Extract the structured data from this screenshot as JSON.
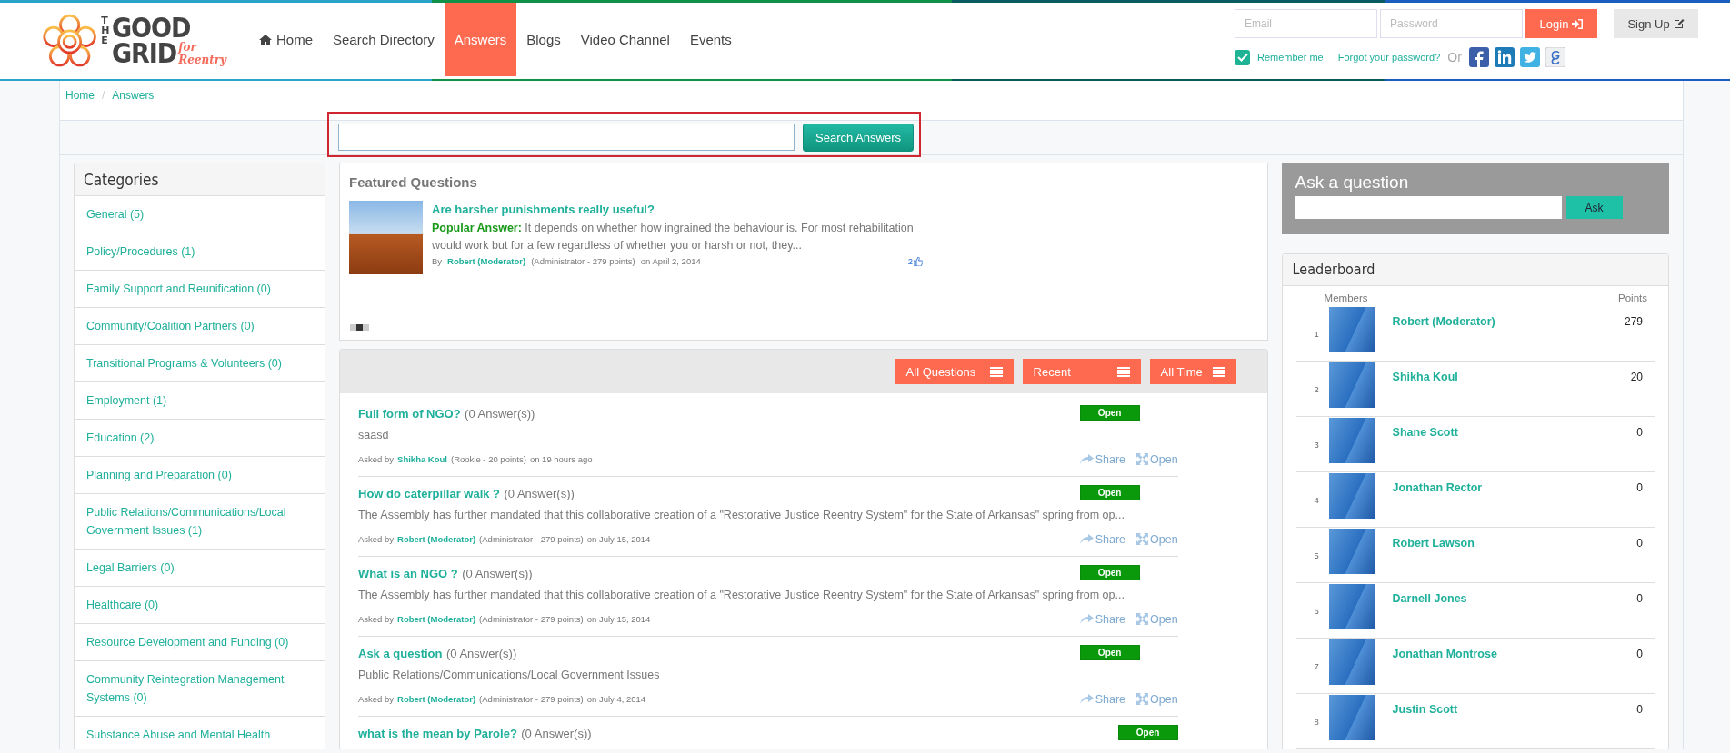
{
  "header": {
    "logo": {
      "the": "THE",
      "line1": "GOOD",
      "line2": "GRID",
      "tagline": "for Reentry"
    },
    "nav": [
      {
        "label": "Home",
        "kind": "home",
        "selected": false
      },
      {
        "label": "Search Directory",
        "kind": "link",
        "selected": false
      },
      {
        "label": "Answers",
        "kind": "link",
        "selected": true
      },
      {
        "label": "Blogs",
        "kind": "link",
        "selected": false
      },
      {
        "label": "Video Channel",
        "kind": "link",
        "selected": false
      },
      {
        "label": "Events",
        "kind": "link",
        "selected": false
      }
    ],
    "login": {
      "email_placeholder": "Email",
      "password_placeholder": "Password",
      "login_button": "Login",
      "signup_button": "Sign Up",
      "remember": {
        "label": "Remember me",
        "checked": true
      },
      "forgot": "Forgot your password?",
      "or": "Or"
    }
  },
  "breadcrumb": {
    "items": [
      "Home",
      "Answers"
    ],
    "separator": "/"
  },
  "search": {
    "button": "Search Answers"
  },
  "categories": {
    "title": "Categories",
    "items": [
      "General (5)",
      "Policy/Procedures (1)",
      "Family Support and Reunification (0)",
      "Community/Coalition Partners (0)",
      "Transitional Programs & Volunteers (0)",
      "Employment (1)",
      "Education (2)",
      "Planning and Preparation (0)",
      "Public Relations/Communications/Local Government Issues (1)",
      "Legal Barriers (0)",
      "Healthcare (0)",
      "Resource Development and Funding (0)",
      "Community Reintegration Management Systems (0)",
      "Substance Abuse and Mental Health"
    ]
  },
  "featured": {
    "title": "Featured Questions",
    "question": "Are harsher punishments really useful?",
    "answer_label": "Popular Answer:",
    "answer": "It depends on whether how ingrained the behaviour is. For most rehabilitation would work but for a few regardless of whether you or harsh or not, they...",
    "by": "By",
    "author": "Robert (Moderator)",
    "role": "(Administrator - 279 points)",
    "date": "on April 2, 2014",
    "likes": "2",
    "dots": [
      {
        "selected": false
      },
      {
        "selected": true
      },
      {
        "selected": false
      }
    ]
  },
  "questions": {
    "filters": [
      {
        "label": "All Questions"
      },
      {
        "label": "Recent"
      },
      {
        "label": "All Time"
      }
    ],
    "items": [
      {
        "title": "Full form of NGO?",
        "count": "(0 Answer(s))",
        "excerpt": "saasd",
        "asked_by": "Asked by",
        "author": "Shikha Koul",
        "role": "(Rookie - 20 points)",
        "date": "on 19 hours ago",
        "status": "Open",
        "share": "Share",
        "open": "Open"
      },
      {
        "title": "How do caterpillar walk ?",
        "count": "(0 Answer(s))",
        "excerpt": "The Assembly has further mandated that this collaborative creation of a \"Restorative Justice Reentry System\" for the State of Arkansas\" spring from op...",
        "asked_by": "Asked by",
        "author": "Robert (Moderator)",
        "role": "(Administrator - 279 points)",
        "date": "on July 15, 2014",
        "status": "Open",
        "share": "Share",
        "open": "Open"
      },
      {
        "title": "What is an NGO ?",
        "count": "(0 Answer(s))",
        "excerpt": "The Assembly has further mandated that this collaborative creation of a \"Restorative Justice Reentry System\" for the State of Arkansas\" spring from op...",
        "asked_by": "Asked by",
        "author": "Robert (Moderator)",
        "role": "(Administrator - 279 points)",
        "date": "on July 15, 2014",
        "status": "Open",
        "share": "Share",
        "open": "Open"
      },
      {
        "title": "Ask a question",
        "count": "(0 Answer(s))",
        "excerpt": "Public Relations/Communications/Local Government Issues",
        "asked_by": "Asked by",
        "author": "Robert (Moderator)",
        "role": "(Administrator - 279 points)",
        "date": "on July 4, 2014",
        "status": "Open",
        "share": "Share",
        "open": "Open"
      },
      {
        "title": "what is the mean by Parole?",
        "count": "(0 Answer(s))",
        "status": "Open"
      }
    ]
  },
  "ask": {
    "title": "Ask a question",
    "button": "Ask"
  },
  "leaderboard": {
    "title": "Leaderboard",
    "members_label": "Members",
    "points_label": "Points",
    "rows": [
      {
        "rank": "1",
        "name": "Robert (Moderator)",
        "points": "279"
      },
      {
        "rank": "2",
        "name": "Shikha Koul",
        "points": "20"
      },
      {
        "rank": "3",
        "name": "Shane Scott",
        "points": "0"
      },
      {
        "rank": "4",
        "name": "Jonathan Rector",
        "points": "0"
      },
      {
        "rank": "5",
        "name": "Robert Lawson",
        "points": "0"
      },
      {
        "rank": "6",
        "name": "Darnell Jones",
        "points": "0"
      },
      {
        "rank": "7",
        "name": "Jonathan Montrose",
        "points": "0"
      },
      {
        "rank": "8",
        "name": "Justin Scott",
        "points": "0"
      }
    ]
  }
}
